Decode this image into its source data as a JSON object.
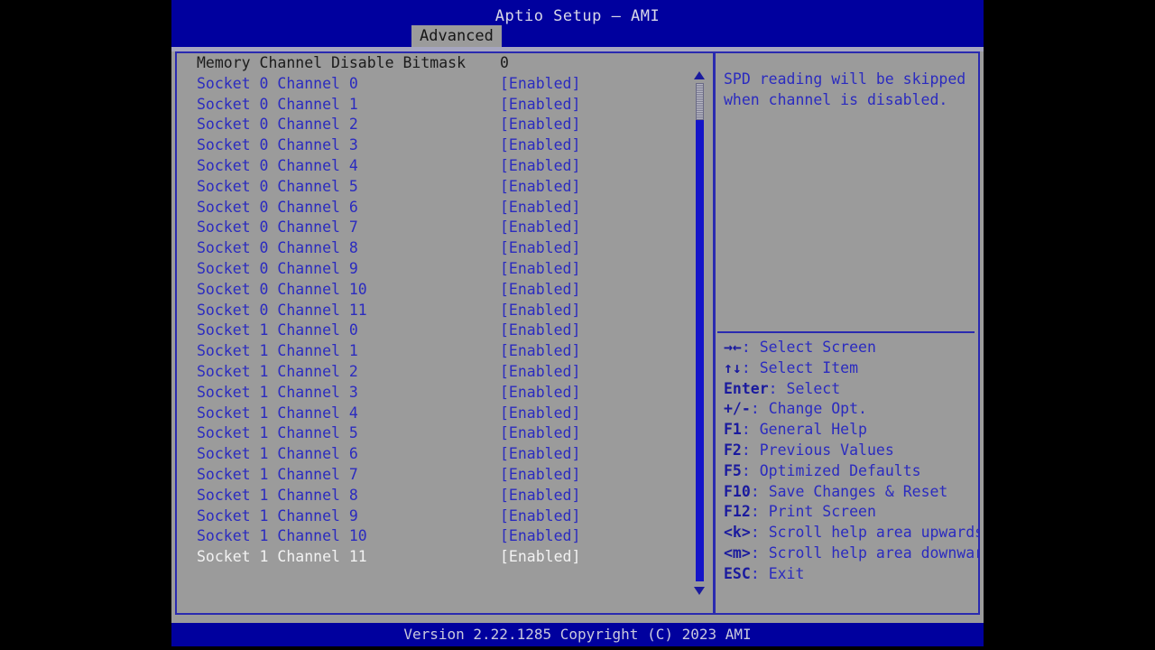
{
  "window": {
    "title": "Aptio Setup – AMI",
    "footer": "Version 2.22.1285 Copyright (C) 2023 AMI"
  },
  "tabs": [
    {
      "label": "Advanced",
      "active": true
    }
  ],
  "colors": {
    "header_blue": "#00009e",
    "panel_grey": "#9b9b9b",
    "item_blue": "#2b2bbf",
    "static_text": "#1b1b1b",
    "selected_text": "#f2f2f2",
    "border_blue": "#2a2ab0",
    "scrollbar_blue": "#1414c8"
  },
  "settings": [
    {
      "label": "Memory Channel Disable Bitmask",
      "value": "0",
      "state": "static"
    },
    {
      "label": "Socket 0 Channel 0",
      "value": "[Enabled]",
      "state": "normal"
    },
    {
      "label": "Socket 0 Channel 1",
      "value": "[Enabled]",
      "state": "normal"
    },
    {
      "label": "Socket 0 Channel 2",
      "value": "[Enabled]",
      "state": "normal"
    },
    {
      "label": "Socket 0 Channel 3",
      "value": "[Enabled]",
      "state": "normal"
    },
    {
      "label": "Socket 0 Channel 4",
      "value": "[Enabled]",
      "state": "normal"
    },
    {
      "label": "Socket 0 Channel 5",
      "value": "[Enabled]",
      "state": "normal"
    },
    {
      "label": "Socket 0 Channel 6",
      "value": "[Enabled]",
      "state": "normal"
    },
    {
      "label": "Socket 0 Channel 7",
      "value": "[Enabled]",
      "state": "normal"
    },
    {
      "label": "Socket 0 Channel 8",
      "value": "[Enabled]",
      "state": "normal"
    },
    {
      "label": "Socket 0 Channel 9",
      "value": "[Enabled]",
      "state": "normal"
    },
    {
      "label": "Socket 0 Channel 10",
      "value": "[Enabled]",
      "state": "normal"
    },
    {
      "label": "Socket 0 Channel 11",
      "value": "[Enabled]",
      "state": "normal"
    },
    {
      "label": "Socket 1 Channel 0",
      "value": "[Enabled]",
      "state": "normal"
    },
    {
      "label": "Socket 1 Channel 1",
      "value": "[Enabled]",
      "state": "normal"
    },
    {
      "label": "Socket 1 Channel 2",
      "value": "[Enabled]",
      "state": "normal"
    },
    {
      "label": "Socket 1 Channel 3",
      "value": "[Enabled]",
      "state": "normal"
    },
    {
      "label": "Socket 1 Channel 4",
      "value": "[Enabled]",
      "state": "normal"
    },
    {
      "label": "Socket 1 Channel 5",
      "value": "[Enabled]",
      "state": "normal"
    },
    {
      "label": "Socket 1 Channel 6",
      "value": "[Enabled]",
      "state": "normal"
    },
    {
      "label": "Socket 1 Channel 7",
      "value": "[Enabled]",
      "state": "normal"
    },
    {
      "label": "Socket 1 Channel 8",
      "value": "[Enabled]",
      "state": "normal"
    },
    {
      "label": "Socket 1 Channel 9",
      "value": "[Enabled]",
      "state": "normal"
    },
    {
      "label": "Socket 1 Channel 10",
      "value": "[Enabled]",
      "state": "normal"
    },
    {
      "label": "Socket 1 Channel 11",
      "value": "[Enabled]",
      "state": "selected"
    }
  ],
  "scrollbar": {
    "up_arrow_icon": "triangle-up-icon",
    "down_arrow_icon": "triangle-down-icon",
    "thumb_position_pct": 0,
    "thumb_size_pct": 7
  },
  "help": {
    "text": "SPD reading will be skipped\nwhen channel is disabled.",
    "legend": [
      {
        "key": "→←",
        "sep": ": ",
        "desc": "Select Screen"
      },
      {
        "key": "↑↓",
        "sep": ": ",
        "desc": "Select Item"
      },
      {
        "key": "Enter",
        "sep": ": ",
        "desc": "Select"
      },
      {
        "key": "+/-",
        "sep": ": ",
        "desc": "Change Opt."
      },
      {
        "key": "F1",
        "sep": ": ",
        "desc": "General Help"
      },
      {
        "key": "F2",
        "sep": ": ",
        "desc": "Previous Values"
      },
      {
        "key": "F5",
        "sep": ": ",
        "desc": "Optimized Defaults"
      },
      {
        "key": "F10",
        "sep": ": ",
        "desc": "Save Changes & Reset"
      },
      {
        "key": "F12",
        "sep": ": ",
        "desc": "Print Screen"
      },
      {
        "key": "<k>",
        "sep": ": ",
        "desc": "Scroll help area upwards"
      },
      {
        "key": "<m>",
        "sep": ": ",
        "desc": "Scroll help area downwards"
      },
      {
        "key": "ESC",
        "sep": ": ",
        "desc": "Exit"
      }
    ]
  }
}
